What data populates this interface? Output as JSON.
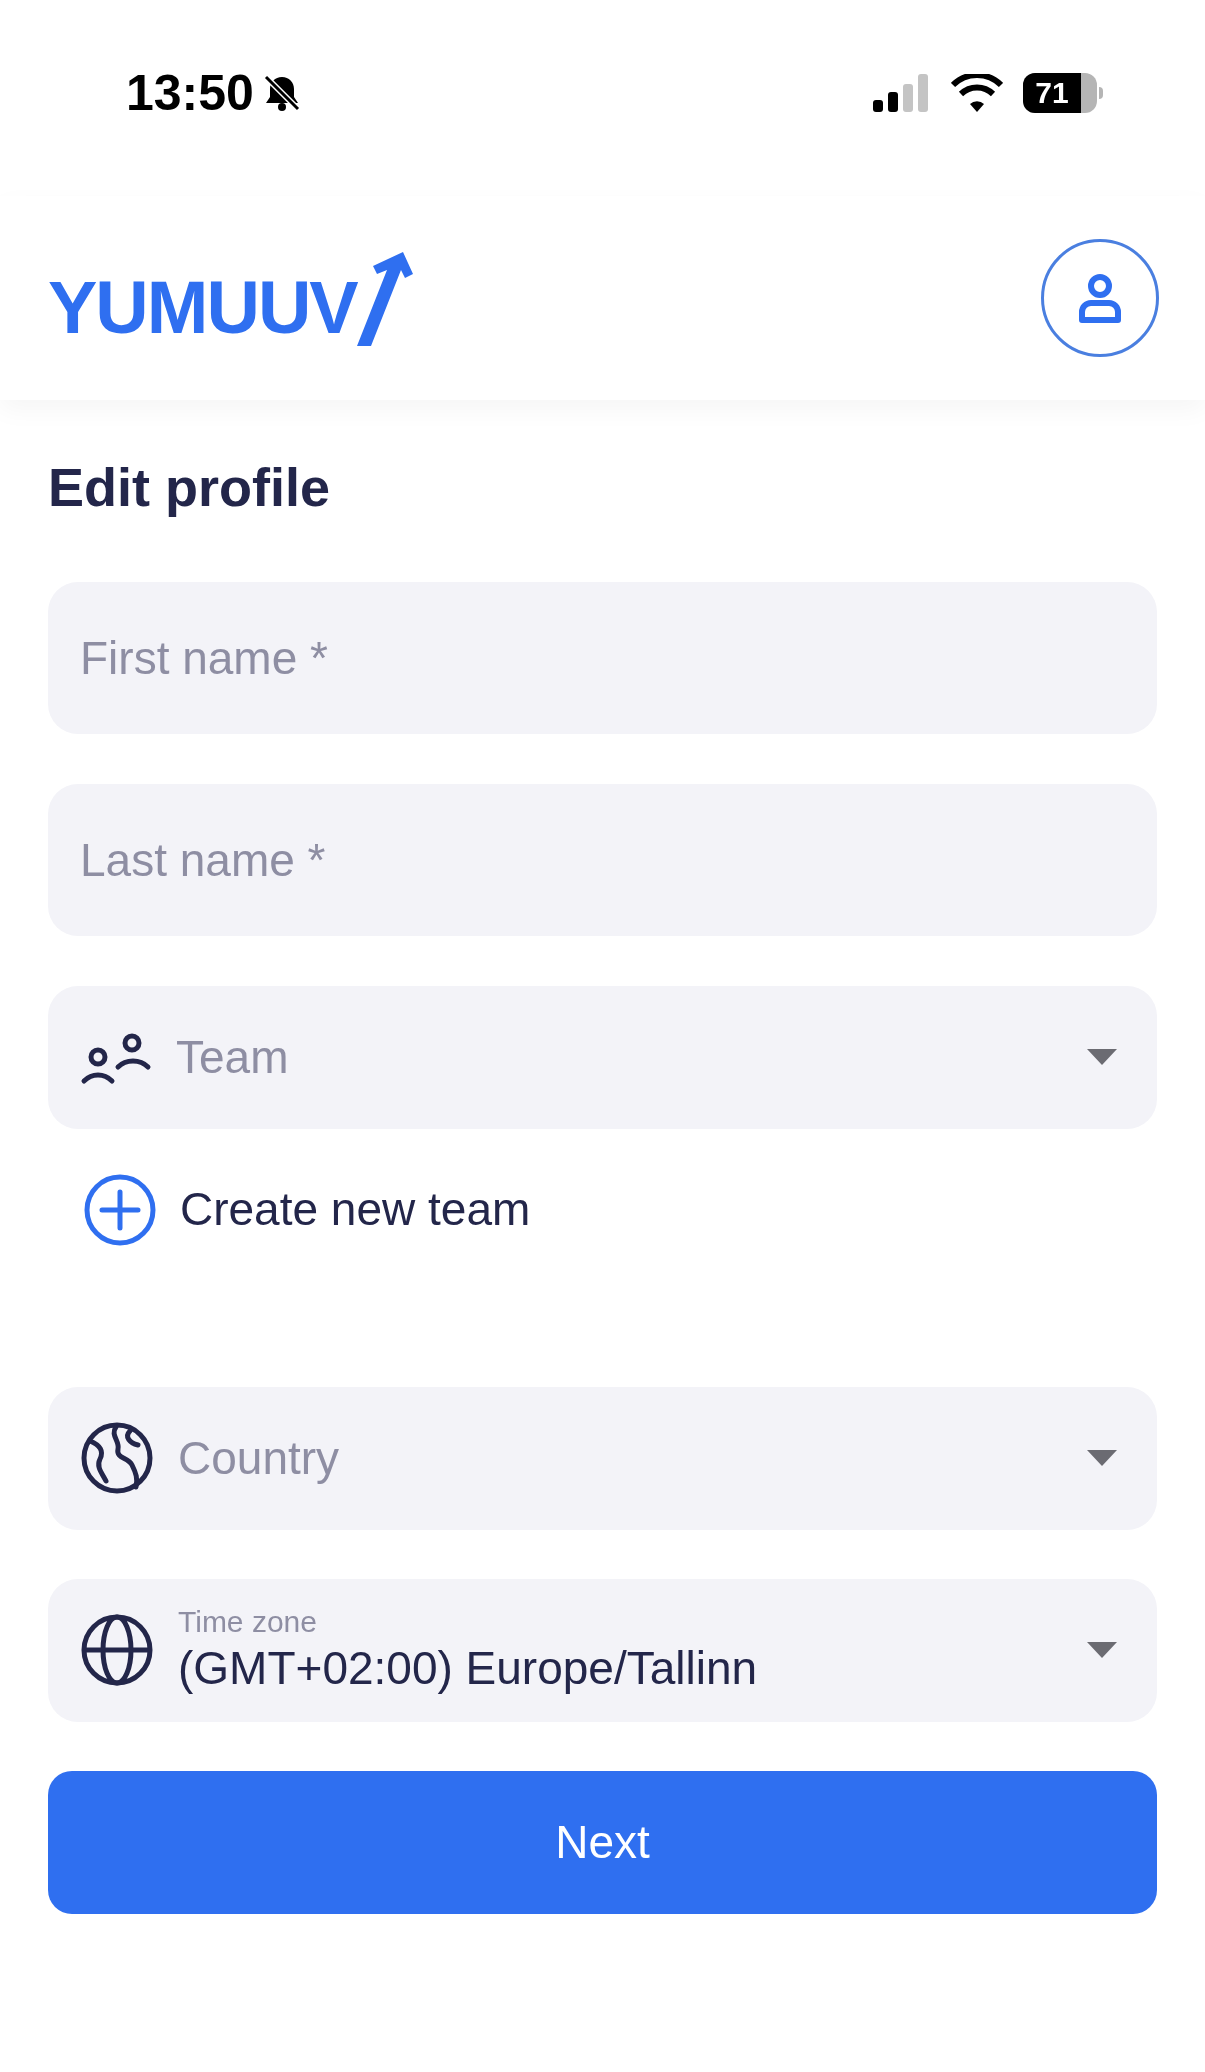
{
  "status_bar": {
    "time": "13:50",
    "battery": "71"
  },
  "header": {
    "logo": "YUMUUV"
  },
  "title": "Edit profile",
  "fields": [
    {
      "kind": "text",
      "placeholder": "First name *"
    },
    {
      "kind": "text",
      "placeholder": "Last name *"
    },
    {
      "kind": "team",
      "placeholder": "Team"
    },
    {
      "kind": "create",
      "label": "Create new team"
    },
    {
      "kind": "country",
      "placeholder": "Country"
    },
    {
      "kind": "timezone",
      "label": "Time zone",
      "value": "(GMT+02:00) Europe/Tallinn"
    }
  ],
  "next_button": "Next"
}
